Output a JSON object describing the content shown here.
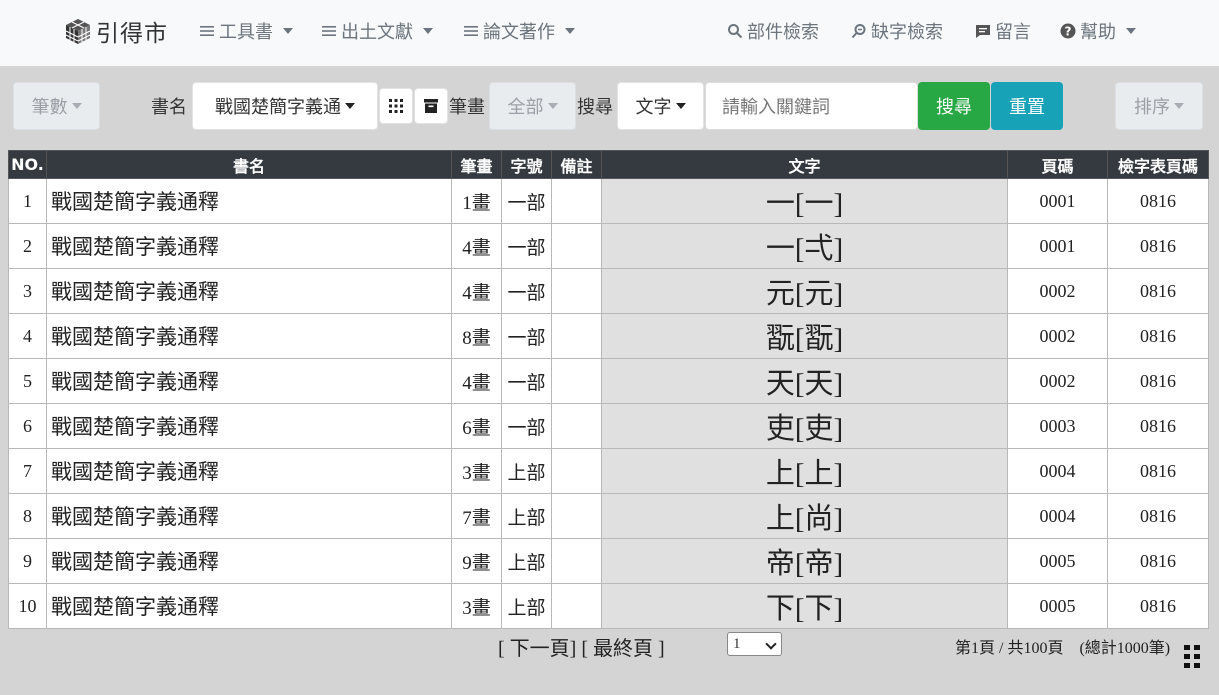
{
  "brand": {
    "name": "引得市"
  },
  "nav": {
    "tools": "工具書",
    "excavated": "出土文獻",
    "papers": "論文著作",
    "component_search": "部件檢索",
    "missing_char_search": "缺字檢索",
    "message": "留言",
    "help": "幫助"
  },
  "toolbar": {
    "stroke_count": "筆數",
    "book_label": "書名",
    "book_value": "戰國楚簡字義通",
    "stroke_label": "筆畫",
    "stroke_value": "全部",
    "search_label": "搜尋",
    "search_type": "文字",
    "search_placeholder": "請輸入關鍵詞",
    "search_button": "搜尋",
    "reset_button": "重置",
    "sort_button": "排序"
  },
  "table": {
    "headers": [
      "NO.",
      "書名",
      "筆畫",
      "字號",
      "備註",
      "文字",
      "頁碼",
      "檢字表頁碼"
    ],
    "rows": [
      {
        "no": "1",
        "book": "戰國楚簡字義通釋",
        "strokes": "1畫",
        "radical": "一部",
        "note": "",
        "char": "一[一]",
        "page": "0001",
        "index_page": "0816"
      },
      {
        "no": "2",
        "book": "戰國楚簡字義通釋",
        "strokes": "4畫",
        "radical": "一部",
        "note": "",
        "char": "一[弌]",
        "page": "0001",
        "index_page": "0816"
      },
      {
        "no": "3",
        "book": "戰國楚簡字義通釋",
        "strokes": "4畫",
        "radical": "一部",
        "note": "",
        "char": "元[元]",
        "page": "0002",
        "index_page": "0816"
      },
      {
        "no": "4",
        "book": "戰國楚簡字義通釋",
        "strokes": "8畫",
        "radical": "一部",
        "note": "",
        "char": "翫[翫]",
        "page": "0002",
        "index_page": "0816"
      },
      {
        "no": "5",
        "book": "戰國楚簡字義通釋",
        "strokes": "4畫",
        "radical": "一部",
        "note": "",
        "char": "天[天]",
        "page": "0002",
        "index_page": "0816"
      },
      {
        "no": "6",
        "book": "戰國楚簡字義通釋",
        "strokes": "6畫",
        "radical": "一部",
        "note": "",
        "char": "吏[吏]",
        "page": "0003",
        "index_page": "0816"
      },
      {
        "no": "7",
        "book": "戰國楚簡字義通釋",
        "strokes": "3畫",
        "radical": "上部",
        "note": "",
        "char": "上[上]",
        "page": "0004",
        "index_page": "0816"
      },
      {
        "no": "8",
        "book": "戰國楚簡字義通釋",
        "strokes": "7畫",
        "radical": "上部",
        "note": "",
        "char": "上[尚]",
        "page": "0004",
        "index_page": "0816"
      },
      {
        "no": "9",
        "book": "戰國楚簡字義通釋",
        "strokes": "9畫",
        "radical": "上部",
        "note": "",
        "char": "帝[帝]",
        "page": "0005",
        "index_page": "0816"
      },
      {
        "no": "10",
        "book": "戰國楚簡字義通釋",
        "strokes": "3畫",
        "radical": "上部",
        "note": "",
        "char": "下[下]",
        "page": "0005",
        "index_page": "0816"
      }
    ]
  },
  "footer": {
    "next_page": "[ 下一頁]",
    "last_page": "[ 最終頁 ]",
    "page_select_value": "1",
    "page_info": "第1頁 / 共100頁　(總計1000筆)"
  }
}
